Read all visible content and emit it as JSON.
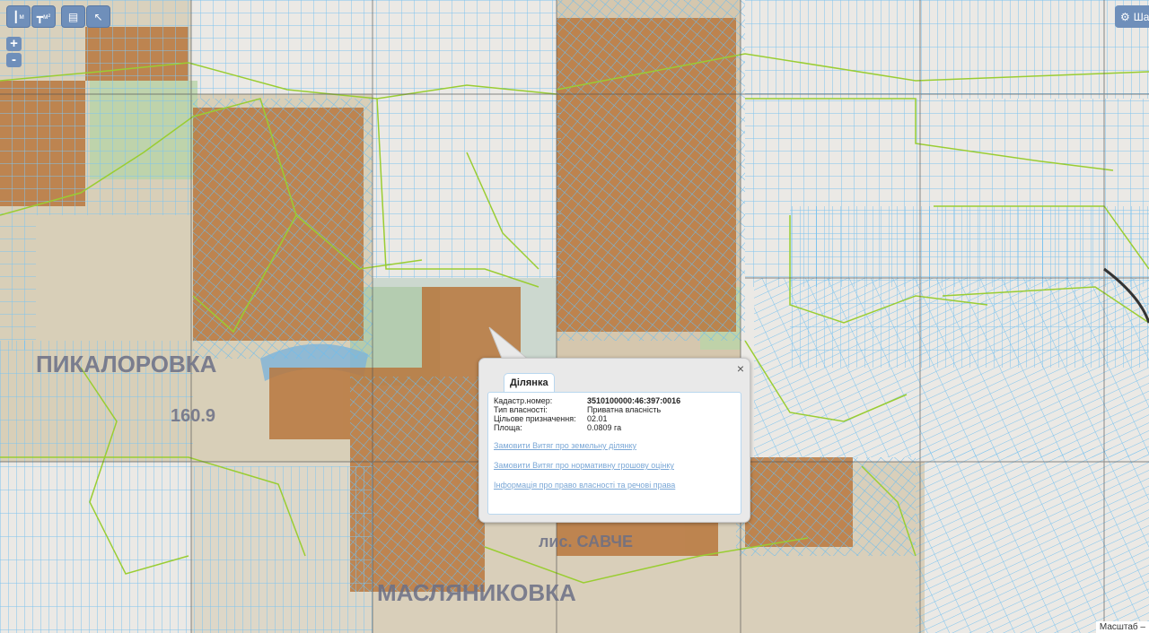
{
  "toolbar": {
    "measure_label": "м",
    "measure_area_label": "м²"
  },
  "zoom": {
    "in": "+",
    "out": "-"
  },
  "layers_button": {
    "label": "Шар"
  },
  "popup": {
    "tab_title": "Ділянка",
    "close_symbol": "×",
    "attributes": [
      {
        "key": "Кадастр.номер:",
        "value": "3510100000:46:397:0016",
        "bold": true
      },
      {
        "key": "Тип власності:",
        "value": "Приватна власність"
      },
      {
        "key": "Цільове призначення:",
        "value": "02.01"
      },
      {
        "key": "Площа:",
        "value": "0.0809 га"
      }
    ],
    "links": [
      "Замовити Витяг про земельну ділянку",
      "Замовити Витяг про нормативну грошову оцінку",
      "Інформація про право власності та речові права"
    ]
  },
  "map_labels": [
    "ПИКАЛОРОВКА",
    "160.9",
    "лис. САВЧЕ",
    "МАСЛЯНИКОВКА"
  ],
  "scale": {
    "label": "Масштаб –"
  },
  "colors": {
    "parcel": "#82c4f0",
    "boundary": "#9acd32",
    "button": "#6f8fba"
  }
}
